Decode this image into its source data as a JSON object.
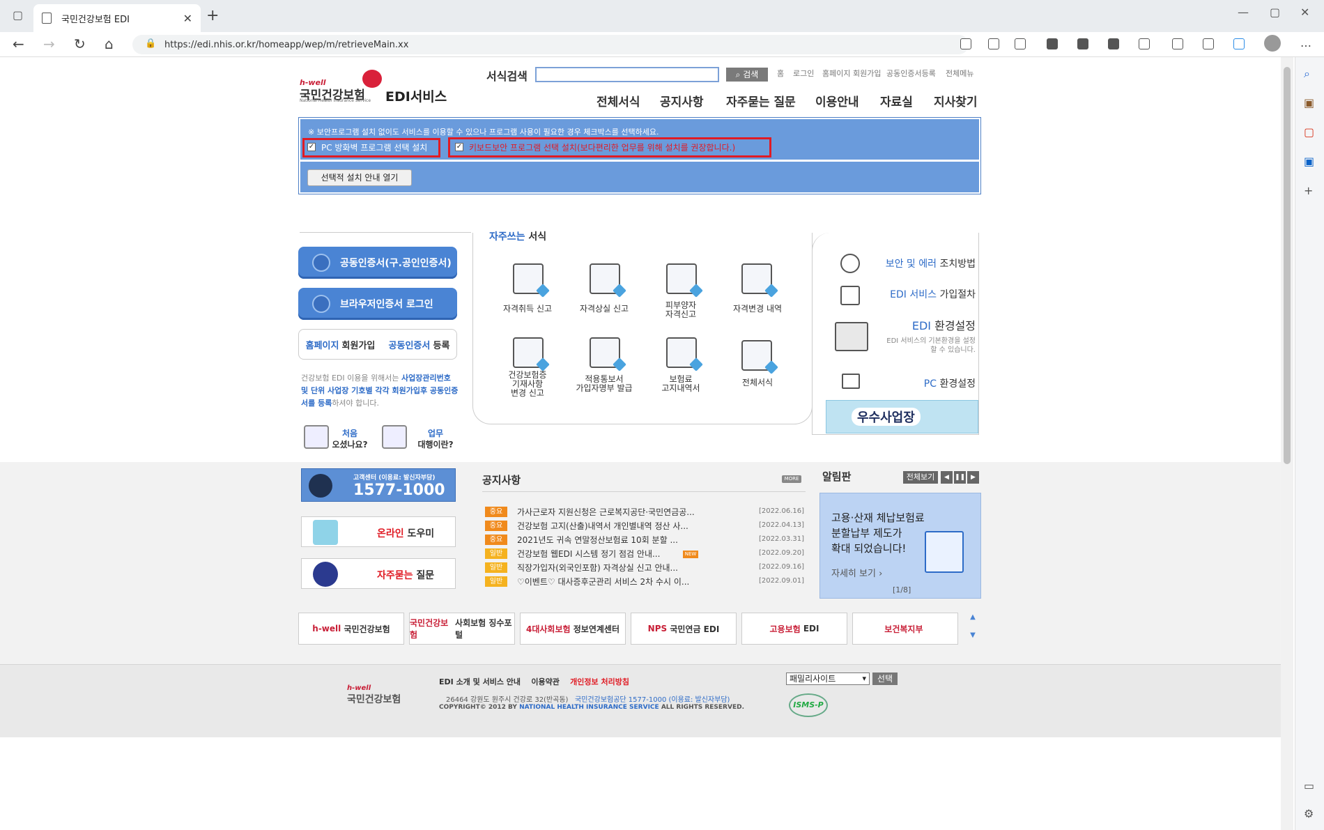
{
  "browser": {
    "tab_title": "국민건강보험 EDI",
    "url": "https://edi.nhis.or.kr/homeapp/wep/m/retrieveMain.xx"
  },
  "header": {
    "logo_hwell": "h-well",
    "logo_name": "국민건강보험",
    "logo_en": "National Health Insurance Service",
    "service_name": "EDI서비스",
    "search_label": "서식검색",
    "search_button": "검색",
    "top_links": [
      "홈",
      "로그인",
      "홈페이지 회원가입",
      "공동인증서등록",
      "전체메뉴"
    ],
    "nav": [
      "전체서식",
      "공지사항",
      "자주묻는 질문",
      "이용안내",
      "자료실",
      "지사찾기"
    ]
  },
  "install": {
    "notice": "※ 보안프로그램 설치 없이도 서비스를 이용할 수 있으나 프로그램 사용이 필요한 경우 체크박스를 선택하세요.",
    "option1": "PC 방화벽 프로그램 선택 설치",
    "option2": "키보드보안 프로그램 선택 설치(보다편리한 업무를 위해 설치를 권장합니다.)",
    "guide_button": "선택적 설치 안내 열기"
  },
  "left": {
    "cert_login": "공동인증서(구.공인인증서)",
    "browser_login": "브라우저인증서 로그인",
    "join_a": "홈페이지",
    "join_b": "회원가입",
    "cert_a": "공동인증서",
    "cert_b": "등록",
    "note_1": "건강보험 EDI 이용을 위해서는 ",
    "note_2": "사업장관리번호 및 단위 사업장 기호별 각각 회원가입후 공동인증서를 등록",
    "note_3": "하셔야 합니다.",
    "first_a": "처음",
    "first_b": "오셨나요?",
    "agent_a": "업무",
    "agent_b": "대행이란?"
  },
  "forms": {
    "title_a": "자주쓰는",
    "title_b": "서식",
    "items": [
      [
        "자격취득 신고"
      ],
      [
        "자격상실 신고"
      ],
      [
        "피부양자",
        "자격신고"
      ],
      [
        "자격변경 내역"
      ],
      [
        "건강보험증",
        "기재사항",
        "변경 신고"
      ],
      [
        "적용통보서",
        "가입자명부 발급"
      ],
      [
        "보험료",
        "고지내역서"
      ],
      [
        "전체서식"
      ]
    ]
  },
  "right": {
    "sec_a": "보안 및 에러",
    "sec_b": "조치방법",
    "join_a": "EDI 서비스",
    "join_b": "가입절차",
    "env_a": "EDI",
    "env_b": "환경설정",
    "env_desc": "EDI 서비스의 기본환경을 설정 할 수 있습니다.",
    "pc_a": "PC",
    "pc_b": "환경설정",
    "banner": "우수사업장"
  },
  "customer": {
    "label": "고객센터 (이용료: 발신자부담)",
    "phone": "1577-1000",
    "online_a": "온라인",
    "online_b": "도우미",
    "faq_a": "자주묻는",
    "faq_b": "질문"
  },
  "notices": {
    "title": "공지사항",
    "more": "MORE",
    "rows": [
      {
        "tag": "중요",
        "kind": "imp",
        "text": "가사근로자 지원신청은 근로복지공단·국민연금공...",
        "date": "[2022.06.16]"
      },
      {
        "tag": "중요",
        "kind": "imp",
        "text": "건강보험 고지(산출)내역서 개인별내역 정산 사...",
        "date": "[2022.04.13]"
      },
      {
        "tag": "중요",
        "kind": "imp",
        "text": "2021년도 귀속 연말정산보험료 10회 분할 ...",
        "date": "[2022.03.31]"
      },
      {
        "tag": "일반",
        "kind": "gen",
        "text": "건강보험 웹EDI 시스템 정기 점검 안내...",
        "date": "[2022.09.20]",
        "new": "NEW"
      },
      {
        "tag": "일반",
        "kind": "gen",
        "text": "직장가입자(외국인포함) 자격상실 신고 안내...",
        "date": "[2022.09.16]"
      },
      {
        "tag": "일반",
        "kind": "gen",
        "text": "♡이벤트♡ 대사증후군관리 서비스 2차 수시 이...",
        "date": "[2022.09.01]"
      }
    ]
  },
  "board": {
    "title": "알림판",
    "all_button": "전체보기",
    "text_1": "고용·산재 체납보험료",
    "text_2": "분할납부 제도가",
    "text_3": "확대 되었습니다!",
    "detail": "자세히 보기",
    "page": "[1/8]"
  },
  "partners": [
    {
      "a": "h-well",
      "b": "국민건강보험"
    },
    {
      "a": "국민건강보험",
      "b": "사회보험 징수포털"
    },
    {
      "a": "4대사회보험",
      "b": "정보연계센터"
    },
    {
      "a": "NPS",
      "b": "국민연금 EDI"
    },
    {
      "a": "고용보험",
      "b": "EDI"
    },
    {
      "a": "보건복지부",
      "b": ""
    }
  ],
  "footer": {
    "link1": "EDI 소개 및 서비스 안내",
    "link2": "이용약관",
    "link3": "개인정보 처리방침",
    "addr": "26464 강원도 원주시 건강로 32(반곡동)",
    "corp": "국민건강보험공단 1577-1000 (이용료: 발신자부담)",
    "copy_a": "COPYRIGHT© 2012 BY",
    "copy_b": "NATIONAL HEALTH INSURANCE SERVICE",
    "copy_c": "ALL RIGHTS RESERVED.",
    "family": "패밀리사이트",
    "select": "선택",
    "isms": "ISMS-P"
  }
}
